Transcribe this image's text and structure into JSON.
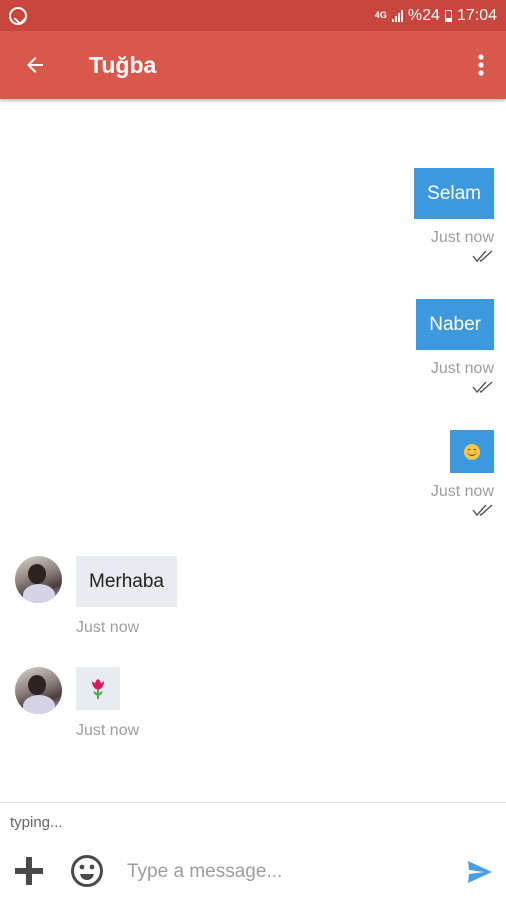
{
  "status_bar": {
    "network": "4G",
    "battery": "%24",
    "time": "17:04",
    "icons": [
      "whatsapp-icon",
      "signal-icon",
      "battery-icon"
    ]
  },
  "app_bar": {
    "title": "Tuğba",
    "back_icon": "arrow-left-icon",
    "menu_icon": "more-vert-icon"
  },
  "messages": [
    {
      "direction": "outgoing",
      "text": "Selam",
      "time": "Just now",
      "status": "double-check"
    },
    {
      "direction": "outgoing",
      "text": "Naber",
      "time": "Just now",
      "status": "double-check"
    },
    {
      "direction": "outgoing",
      "emoji": "smiling-face-emoji",
      "time": "Just now",
      "status": "double-check"
    },
    {
      "direction": "incoming",
      "text": "Merhaba",
      "time": "Just now"
    },
    {
      "direction": "incoming",
      "emoji": "tulip-emoji",
      "time": "Just now"
    }
  ],
  "composer": {
    "typing": "typing...",
    "placeholder": "Type a message...",
    "icons": [
      "plus-icon",
      "smiley-icon",
      "send-icon"
    ]
  },
  "colors": {
    "status_bar": "#c9463c",
    "app_bar": "#d9584c",
    "outgoing_bubble": "#3d99dd",
    "incoming_bubble": "#e8ecf0",
    "send_icon": "#4a9fe0"
  }
}
